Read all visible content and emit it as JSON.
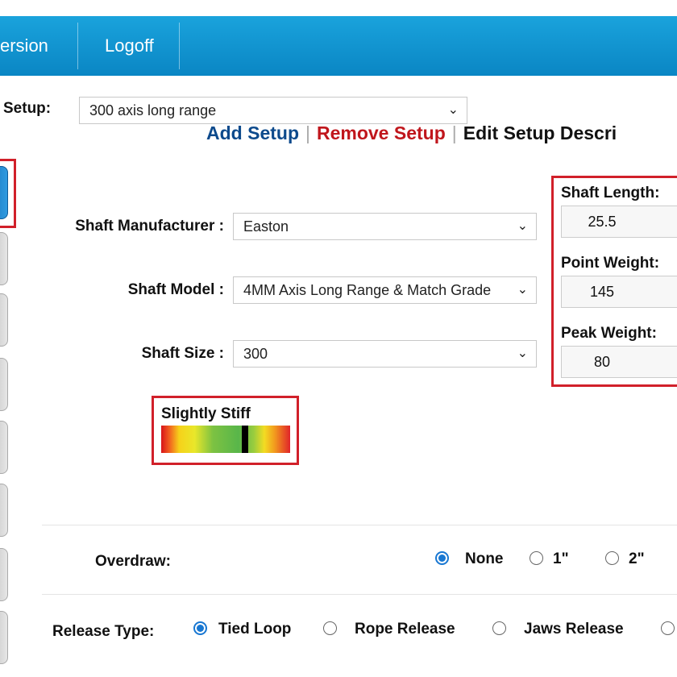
{
  "nav": {
    "items": [
      {
        "label": "ersion"
      },
      {
        "label": "Logoff"
      }
    ]
  },
  "setup": {
    "label": "Setup:",
    "selected": "300 axis long range",
    "links": {
      "add": "Add Setup",
      "remove": "Remove Setup",
      "edit": "Edit Setup Descri"
    }
  },
  "shaft": {
    "manufacturer_label": "Shaft Manufacturer :",
    "manufacturer_value": "Easton",
    "model_label": "Shaft Model :",
    "model_value": "4MM Axis Long Range & Match Grade",
    "size_label": "Shaft Size :",
    "size_value": "300"
  },
  "spine": {
    "label": "Slightly Stiff",
    "marker_position": 0.65,
    "colors": [
      "#d7141a",
      "#f6d21a",
      "#58b64a",
      "#f3dc22",
      "#e0242a"
    ]
  },
  "side": {
    "length_label": "Shaft Length:",
    "length_value": "25.5",
    "point_label": "Point Weight:",
    "point_value": "145",
    "peak_label": "Peak Weight:",
    "peak_value": "80"
  },
  "overdraw": {
    "label": "Overdraw:",
    "options": [
      {
        "label": "None",
        "selected": true
      },
      {
        "label": "1\"",
        "selected": false
      },
      {
        "label": "2\"",
        "selected": false
      }
    ]
  },
  "release": {
    "label": "Release Type:",
    "options": [
      {
        "label": "Tied Loop",
        "selected": true
      },
      {
        "label": "Rope Release",
        "selected": false
      },
      {
        "label": "Jaws Release",
        "selected": false
      }
    ]
  },
  "colors": {
    "topbar": "#0a86c4",
    "highlight": "#d1202a",
    "add_link": "#0d4a8c",
    "remove_link": "#c0161c",
    "radio_selected": "#1877d2"
  },
  "icons": {
    "dropdown": "chevron-down-icon",
    "radio_on": "radio-selected",
    "radio_off": "radio-unselected"
  }
}
